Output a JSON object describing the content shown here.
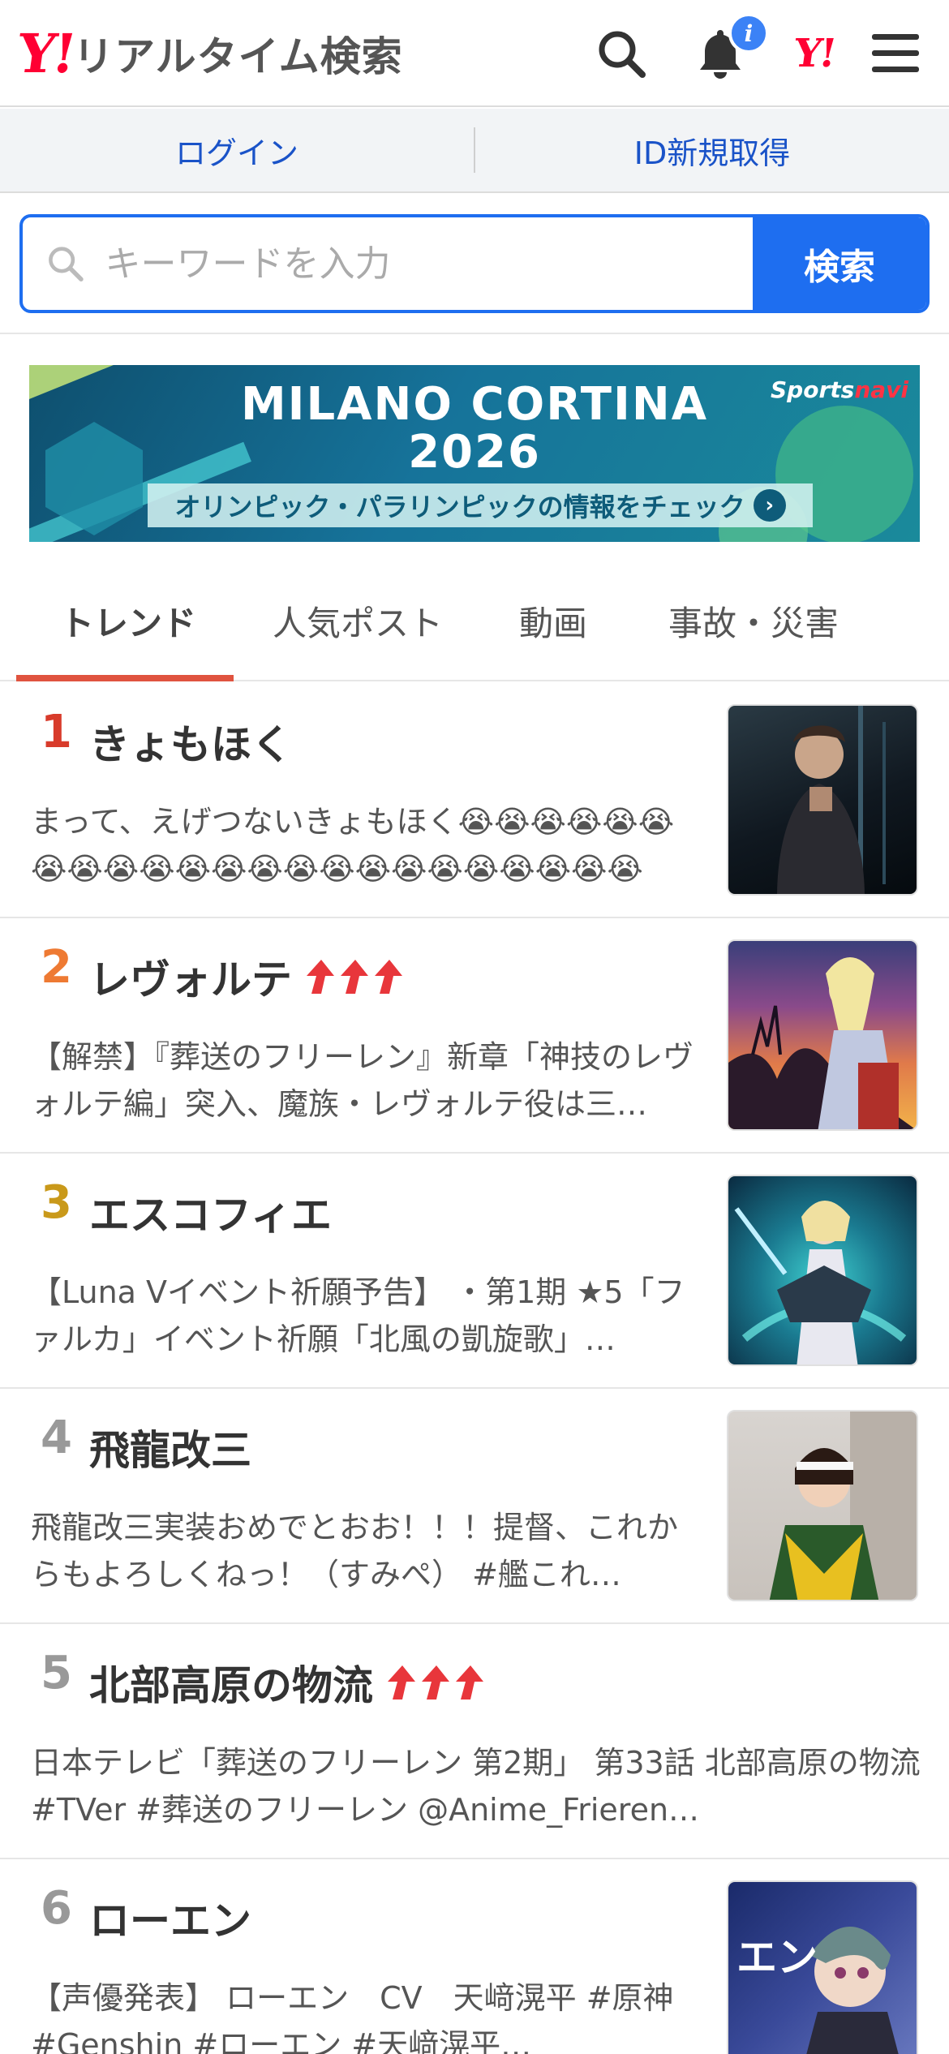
{
  "header": {
    "logo_mark": "Y!",
    "logo_text": "リアルタイム検索",
    "notification_badge": "i",
    "yj_mark": "Y!"
  },
  "login_bar": {
    "login": "ログイン",
    "register": "ID新規取得"
  },
  "search": {
    "placeholder": "キーワードを入力",
    "button": "検索"
  },
  "banner": {
    "title_line1": "MILANO CORTINA",
    "title_line2": "2026",
    "subtitle": "オリンピック・パラリンピックの情報をチェック",
    "brand_a": "Sports",
    "brand_b": "navi"
  },
  "tabs": [
    {
      "label": "トレンド",
      "active": true
    },
    {
      "label": "人気ポスト",
      "active": false
    },
    {
      "label": "動画",
      "active": false
    },
    {
      "label": "事故・災害",
      "active": false
    }
  ],
  "colors": {
    "accent_blue": "#1e6ef0",
    "tab_underline": "#e0533f",
    "rank1": "#d83b2b",
    "rank2": "#ee7a33",
    "rank3": "#c9991a",
    "rank_default": "#999999",
    "trend_up": "#e8363b"
  },
  "ranking": [
    {
      "rank": "1",
      "keyword": "きょもほく",
      "trend_up": false,
      "snippet": "まって、えげつないきょもほく😭😭😭😭😭😭😭😭😭😭😭😭😭😭😭😭😭😭😭😭😭😭😭😭…",
      "has_thumb": true
    },
    {
      "rank": "2",
      "keyword": "レヴォルテ",
      "trend_up": true,
      "snippet": "【解禁】『葬送のフリーレン』新章「神技のレヴォルテ編」突入、魔族・レヴォルテ役は三…",
      "has_thumb": true
    },
    {
      "rank": "3",
      "keyword": "エスコフィエ",
      "trend_up": false,
      "snippet": "【Luna Vイベント祈願予告】 ・第1期 ★5「ファルカ」イベント祈願「北風の凱旋歌」…",
      "has_thumb": true
    },
    {
      "rank": "4",
      "keyword": "飛龍改三",
      "trend_up": false,
      "snippet": "飛龍改三実装おめでとおお！！！提督、これからもよろしくねっ！（すみぺ） #艦これ…",
      "has_thumb": true
    },
    {
      "rank": "5",
      "keyword": "北部高原の物流",
      "trend_up": true,
      "snippet": "日本テレビ「葬送のフリーレン 第2期」 第33話 北部高原の物流 #TVer #葬送のフリーレン @Anime_Frieren…",
      "has_thumb": false
    },
    {
      "rank": "6",
      "keyword": "ローエン",
      "trend_up": false,
      "snippet": "【声優発表】 ローエン　CV　天﨑滉平 #原神 #Genshin #ローエン #天﨑滉平…",
      "has_thumb": true
    }
  ]
}
